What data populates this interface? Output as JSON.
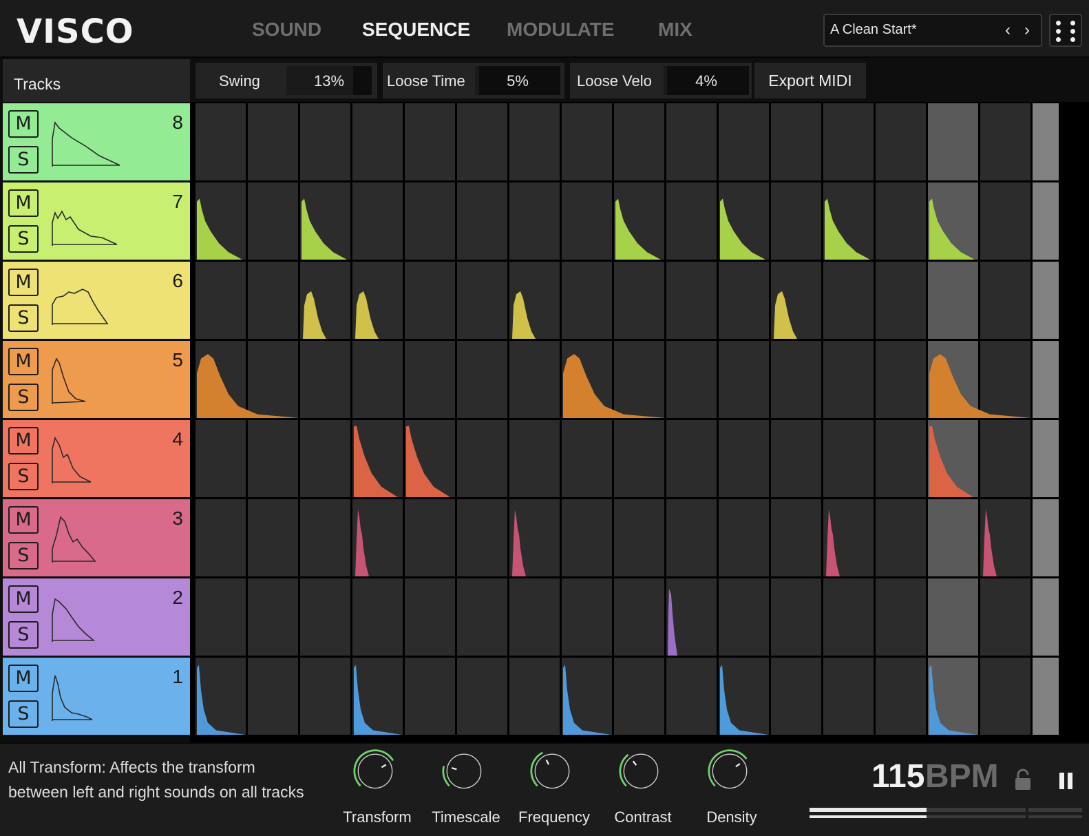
{
  "header": {
    "logo": "VISCO",
    "tabs": [
      {
        "label": "SOUND",
        "active": false
      },
      {
        "label": "SEQUENCE",
        "active": true
      },
      {
        "label": "MODULATE",
        "active": false
      },
      {
        "label": "MIX",
        "active": false
      }
    ],
    "preset_name": "A Clean Start*",
    "prev_icon": "chevron-left-icon",
    "next_icon": "chevron-right-icon",
    "menu_icon": "more-dots-icon"
  },
  "tracks_panel": {
    "title": "Tracks",
    "mute_label": "M",
    "solo_label": "S"
  },
  "controls": {
    "swing": {
      "label": "Swing",
      "value": "13%",
      "fraction": 0.13
    },
    "loose_time": {
      "label": "Loose Time",
      "value": "5%",
      "fraction": 0.05
    },
    "loose_velo": {
      "label": "Loose Velo",
      "value": "4%",
      "fraction": 0.04
    },
    "export_label": "Export MIDI"
  },
  "sequencer": {
    "steps": 16,
    "current_step": 15,
    "tracks": [
      {
        "number": "8",
        "color": "#93ec94",
        "note": "#79cf79",
        "steps": []
      },
      {
        "number": "7",
        "color": "#c8ef70",
        "note": "#a8d14a",
        "steps": [
          1,
          3,
          9,
          11,
          13,
          15
        ]
      },
      {
        "number": "6",
        "color": "#ede273",
        "note": "#cfc14a",
        "steps": [
          3,
          4,
          7,
          12
        ]
      },
      {
        "number": "5",
        "color": "#ee9b4e",
        "note": "#d3802f",
        "steps": [
          1,
          8,
          15
        ]
      },
      {
        "number": "4",
        "color": "#ef7560",
        "note": "#db6346",
        "steps": [
          4,
          5,
          15
        ]
      },
      {
        "number": "3",
        "color": "#d96a8a",
        "note": "#c85474",
        "steps": [
          4,
          7,
          13,
          16
        ]
      },
      {
        "number": "2",
        "color": "#b589d8",
        "note": "#9c6fc7",
        "steps": [
          10
        ]
      },
      {
        "number": "1",
        "color": "#6bb2ed",
        "note": "#4f9ada",
        "steps": [
          1,
          4,
          8,
          11,
          15
        ]
      }
    ]
  },
  "footer": {
    "help_text": "All Transform: Affects the transform between left and right sounds on all tracks",
    "knobs": [
      {
        "label": "Transform",
        "value": 0.72
      },
      {
        "label": "Timescale",
        "value": 0.22
      },
      {
        "label": "Frequency",
        "value": 0.4
      },
      {
        "label": "Contrast",
        "value": 0.36
      },
      {
        "label": "Density",
        "value": 0.7
      }
    ],
    "bpm_value": "115",
    "bpm_unit": "BPM",
    "lock_icon": "lock-icon",
    "pause_icon": "pause-icon",
    "playback_progress": 0.54
  }
}
